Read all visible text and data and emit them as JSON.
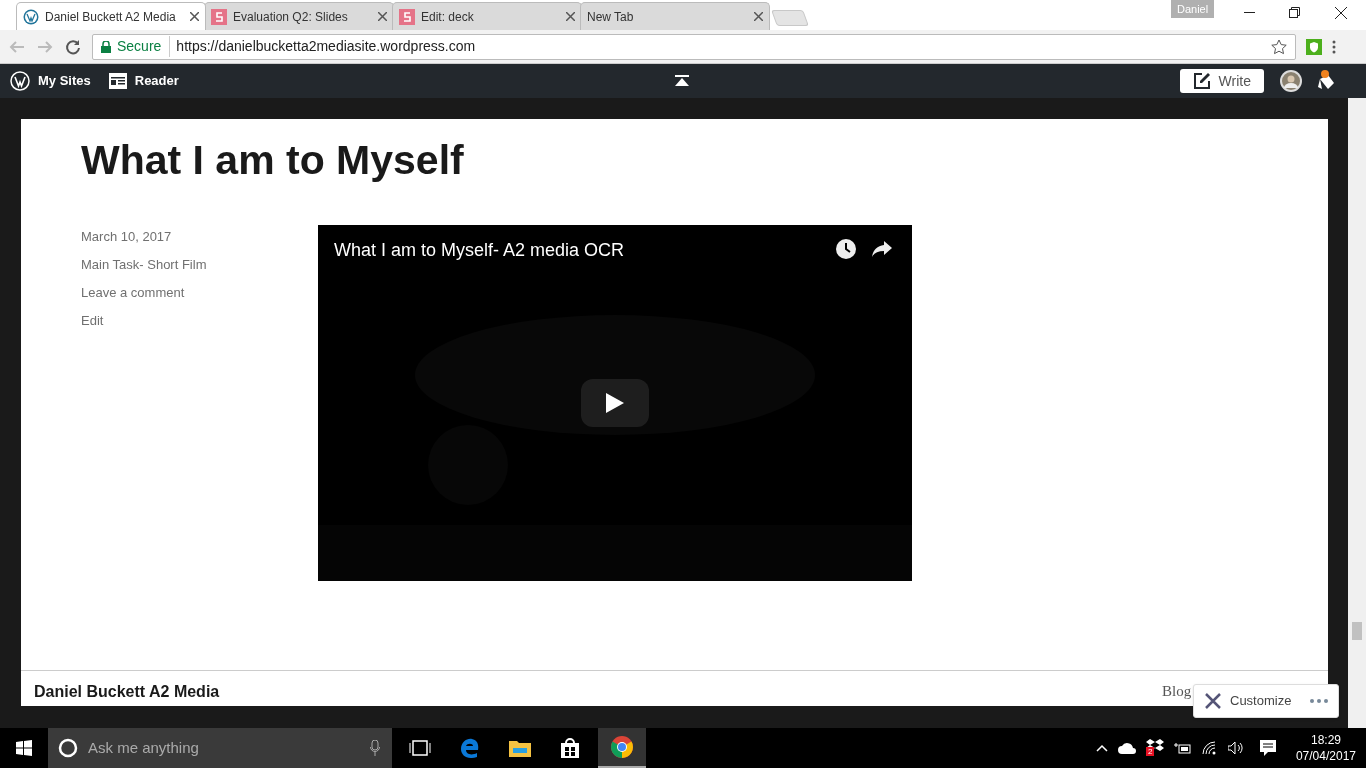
{
  "browser": {
    "tabs": [
      {
        "title": "Daniel Buckett A2 Media",
        "kind": "wordpress",
        "selected": true
      },
      {
        "title": "Evaluation Q2: Slides",
        "kind": "slides",
        "selected": false
      },
      {
        "title": "Edit: deck",
        "kind": "slides",
        "selected": false
      },
      {
        "title": "New Tab",
        "kind": "plain",
        "selected": false
      }
    ],
    "profile": "Daniel",
    "secure_label": "Secure",
    "url": "https://danielbucketta2mediasite.wordpress.com"
  },
  "admin_bar": {
    "items": [
      "My Sites",
      "Reader"
    ],
    "write": "Write",
    "unread_notifications": true
  },
  "post": {
    "title": "What I am to Myself",
    "meta": [
      "March 10, 2017",
      "Main Task- Short Film",
      "Leave a comment",
      "Edit"
    ],
    "video": {
      "title": "What I am to Myself- A2 media OCR"
    }
  },
  "footer": {
    "site_title": "Daniel Buckett A2 Media",
    "credit": "Blog"
  },
  "customize": {
    "label": "Customize"
  },
  "taskbar": {
    "search_placeholder": "Ask me anything",
    "tray_badge": "2",
    "time": "18:29",
    "date": "07/04/2017"
  }
}
